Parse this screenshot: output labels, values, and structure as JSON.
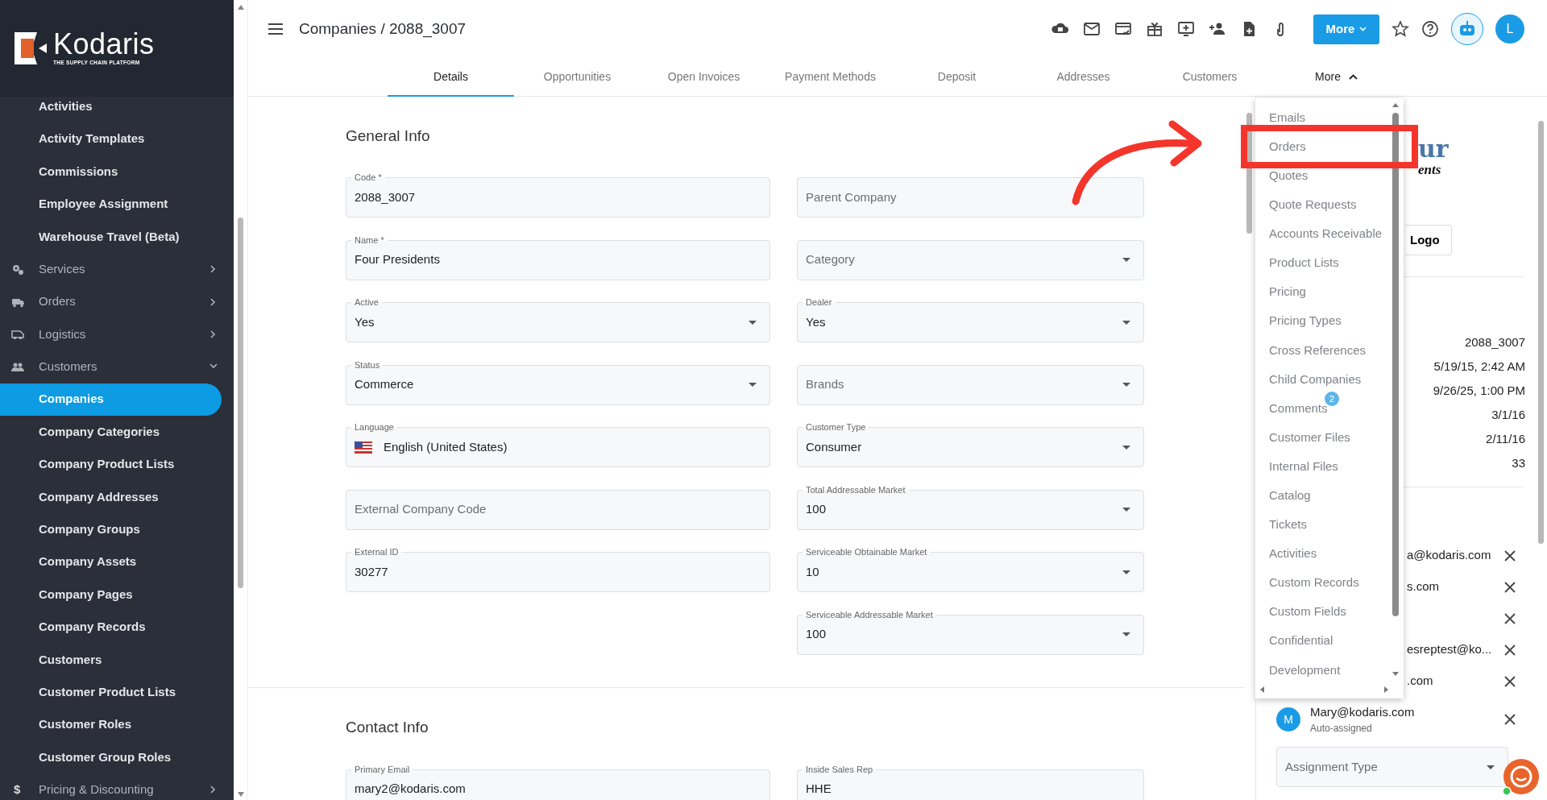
{
  "sidebar": {
    "brand": "Kodaris",
    "tagline": "THE SUPPLY CHAIN PLATFORM",
    "items": [
      {
        "label": "Activities",
        "kind": "sub",
        "selected": false
      },
      {
        "label": "Activity Templates",
        "kind": "sub",
        "selected": false
      },
      {
        "label": "Commissions",
        "kind": "sub",
        "selected": false
      },
      {
        "label": "Employee Assignment",
        "kind": "sub",
        "selected": false
      },
      {
        "label": "Warehouse Travel (Beta)",
        "kind": "sub",
        "selected": false
      },
      {
        "label": "Services",
        "kind": "group",
        "expanded": false
      },
      {
        "label": "Orders",
        "kind": "group",
        "expanded": false
      },
      {
        "label": "Logistics",
        "kind": "group",
        "expanded": false
      },
      {
        "label": "Customers",
        "kind": "group",
        "expanded": true
      },
      {
        "label": "Companies",
        "kind": "sub",
        "selected": true
      },
      {
        "label": "Company Categories",
        "kind": "sub",
        "selected": false
      },
      {
        "label": "Company Product Lists",
        "kind": "sub",
        "selected": false
      },
      {
        "label": "Company Addresses",
        "kind": "sub",
        "selected": false
      },
      {
        "label": "Company Groups",
        "kind": "sub",
        "selected": false
      },
      {
        "label": "Company Assets",
        "kind": "sub",
        "selected": false
      },
      {
        "label": "Company Pages",
        "kind": "sub",
        "selected": false
      },
      {
        "label": "Company Records",
        "kind": "sub",
        "selected": false
      },
      {
        "label": "Customers",
        "kind": "sub",
        "selected": false
      },
      {
        "label": "Customer Product Lists",
        "kind": "sub",
        "selected": false
      },
      {
        "label": "Customer Roles",
        "kind": "sub",
        "selected": false
      },
      {
        "label": "Customer Group Roles",
        "kind": "sub",
        "selected": false
      },
      {
        "label": "Pricing & Discounting",
        "kind": "group",
        "expanded": false,
        "icon": "$"
      }
    ]
  },
  "header": {
    "title": "Companies / 2088_3007",
    "more_button": "More",
    "avatar": "L"
  },
  "tabs": [
    {
      "label": "Details",
      "selected": true
    },
    {
      "label": "Opportunities",
      "selected": false
    },
    {
      "label": "Open Invoices",
      "selected": false
    },
    {
      "label": "Payment Methods",
      "selected": false
    },
    {
      "label": "Deposit",
      "selected": false
    },
    {
      "label": "Addresses",
      "selected": false
    },
    {
      "label": "Customers",
      "selected": false
    },
    {
      "label": "More",
      "selected": false,
      "expanded": true
    }
  ],
  "general_info": {
    "title": "General Info",
    "left_fields": [
      {
        "label": "Code *",
        "value": "2088_3007",
        "kind": "text"
      },
      {
        "label": "Name *",
        "value": "Four Presidents",
        "kind": "text"
      },
      {
        "label": "Active",
        "value": "Yes",
        "kind": "select"
      },
      {
        "label": "Status",
        "value": "Commerce",
        "kind": "select"
      },
      {
        "label": "Language",
        "value": "English (United States)",
        "kind": "language"
      },
      {
        "placeholder": "External Company Code",
        "kind": "text"
      },
      {
        "label": "External ID",
        "value": "30277",
        "kind": "text"
      }
    ],
    "right_fields": [
      {
        "placeholder": "Parent Company",
        "kind": "text"
      },
      {
        "placeholder": "Category",
        "kind": "select"
      },
      {
        "label": "Dealer",
        "value": "Yes",
        "kind": "select"
      },
      {
        "placeholder": "Brands",
        "kind": "select"
      },
      {
        "label": "Customer Type",
        "value": "Consumer",
        "kind": "select"
      },
      {
        "label": "Total Addressable Market",
        "value": "100",
        "kind": "select"
      },
      {
        "label": "Serviceable Obtainable Market",
        "value": "10",
        "kind": "select"
      },
      {
        "label": "Serviceable Addressable Market",
        "value": "100",
        "kind": "select"
      }
    ]
  },
  "contact_info": {
    "title": "Contact Info",
    "left_fields": [
      {
        "label": "Primary Email",
        "value": "mary2@kodaris.com",
        "kind": "text"
      }
    ],
    "right_fields": [
      {
        "label": "Inside Sales Rep",
        "value": "HHE",
        "kind": "text"
      }
    ]
  },
  "more_menu": {
    "items": [
      {
        "label": "Emails"
      },
      {
        "label": "Orders"
      },
      {
        "label": "Quotes"
      },
      {
        "label": "Quote Requests"
      },
      {
        "label": "Accounts Receivable"
      },
      {
        "label": "Product Lists"
      },
      {
        "label": "Pricing"
      },
      {
        "label": "Pricing Types"
      },
      {
        "label": "Cross References"
      },
      {
        "label": "Child Companies"
      },
      {
        "label": "Comments",
        "badge": "2"
      },
      {
        "label": "Customer Files"
      },
      {
        "label": "Internal Files"
      },
      {
        "label": "Catalog"
      },
      {
        "label": "Tickets"
      },
      {
        "label": "Activities"
      },
      {
        "label": "Custom Records"
      },
      {
        "label": "Custom Fields"
      },
      {
        "label": "Confidential"
      },
      {
        "label": "Development"
      }
    ]
  },
  "right_panel": {
    "logo_fragments": [
      "ur",
      "ents"
    ],
    "logo_button": "Logo",
    "values": [
      "2088_3007",
      "5/19/15, 2:42 AM",
      "9/26/25, 1:00 PM",
      "3/1/16",
      "2/11/16",
      "33"
    ],
    "assignees": [
      {
        "text": "a@kodaris.com",
        "removable": true
      },
      {
        "text": "s.com",
        "removable": true
      },
      {
        "removable": true
      },
      {
        "text": "esreptest@ko...",
        "removable": true
      },
      {
        "text": ".com",
        "removable": true
      },
      {
        "initial": "M",
        "text": "Mary@kodaris.com",
        "note": "Auto-assigned",
        "removable": true
      }
    ],
    "assignment_type": {
      "placeholder": "Assignment Type"
    }
  }
}
